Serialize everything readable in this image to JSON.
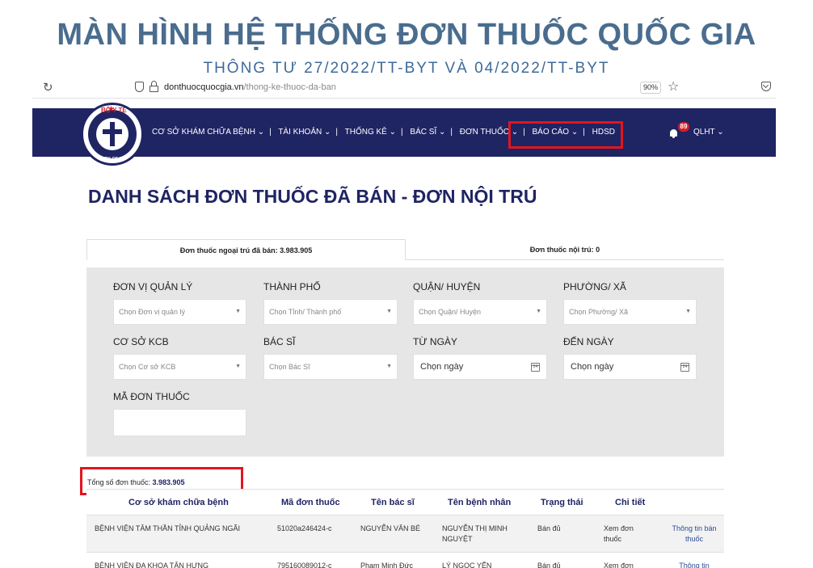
{
  "banner": {
    "title": "MÀN HÌNH HỆ THỐNG ĐƠN THUỐC QUỐC GIA",
    "subtitle": "THÔNG TƯ 27/2022/TT-BYT VÀ 04/2022/TT-BYT"
  },
  "browser": {
    "url_domain": "donthuocquocgia.vn",
    "url_path": "/thong-ke-thuoc-da-ban",
    "zoom": "90%"
  },
  "logo": {
    "top_text": "BỘ Y TẾ",
    "bottom_text": "MINISTRY OF HEALTH"
  },
  "nav": {
    "items": [
      "CƠ SỞ KHÁM CHỮA BỆNH",
      "TÀI KHOẢN",
      "THỐNG KÊ",
      "BÁC SĨ",
      "ĐƠN THUỐC",
      "BÁO CÁO",
      "HDSD"
    ],
    "notification_count": "89",
    "user": "QLHT"
  },
  "page": {
    "heading": "DANH SÁCH ĐƠN THUỐC ĐÃ BÁN - ĐƠN NỘI TRÚ"
  },
  "tabs": {
    "outpatient": "Đơn thuốc ngoại trú đã bán: 3.983.905",
    "inpatient": "Đơn thuốc nội trú: 0"
  },
  "filters": {
    "don_vi": {
      "label": "ĐƠN VỊ QUẢN LÝ",
      "placeholder": "Chọn Đơn vị quản lý"
    },
    "thanh_pho": {
      "label": "THÀNH PHỐ",
      "placeholder": "Chọn Tỉnh/ Thành phố"
    },
    "quan_huyen": {
      "label": "QUẬN/ HUYỆN",
      "placeholder": "Chọn Quận/ Huyện"
    },
    "phuong_xa": {
      "label": "PHƯỜNG/ XÃ",
      "placeholder": "Chọn Phường/ Xã"
    },
    "co_so": {
      "label": "CƠ SỞ KCB",
      "placeholder": "Chọn Cơ sở KCB"
    },
    "bac_si": {
      "label": "BÁC SĨ",
      "placeholder": "Chọn Bác Sĩ"
    },
    "tu_ngay": {
      "label": "TỪ NGÀY",
      "placeholder": "Chọn ngày"
    },
    "den_ngay": {
      "label": "ĐẾN NGÀY",
      "placeholder": "Chọn ngày"
    },
    "ma_don": {
      "label": "MÃ ĐƠN THUỐC",
      "value": ""
    }
  },
  "summary": {
    "label": "Tổng số đơn thuốc:",
    "value": "3.983.905"
  },
  "table": {
    "headers": [
      "Cơ sở khám chữa bệnh",
      "Mã đơn thuốc",
      "Tên bác sĩ",
      "Tên bệnh nhân",
      "Trạng thái",
      "Chi tiết"
    ],
    "rows": [
      {
        "facility": "BỆNH VIỆN TÂM THẦN TỈNH QUẢNG NGÃI",
        "code": "51020a246424-c",
        "doctor": "NGUYỄN VĂN BÉ",
        "patient": "NGUYỄN THỊ MINH NGUYỆT",
        "status": "Bán đủ",
        "detail": "Xem đơn thuốc",
        "info": "Thông tin bán thuốc"
      },
      {
        "facility": "BỆNH VIỆN ĐA KHOA TÂN HƯNG",
        "code": "795160089012-c",
        "doctor": "Phạm Minh Đức",
        "patient": "LÝ NGỌC YẾN",
        "status": "Bán đủ",
        "detail": "Xem đơn",
        "info": "Thông tin"
      }
    ]
  },
  "colors": {
    "navy": "#1f2463",
    "highlight_red": "#e3151e",
    "banner_blue": "#4a6d8e"
  }
}
